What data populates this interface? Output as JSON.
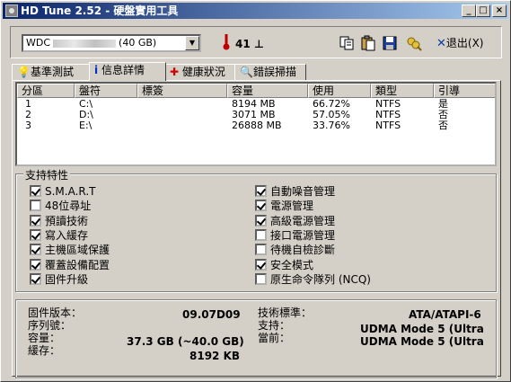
{
  "window": {
    "title": "HD Tune 2.52 - 硬盤實用工具",
    "min": "_",
    "max": "□",
    "close": "×"
  },
  "toolbar": {
    "drive_prefix": "WDC",
    "drive_suffix": "(40 GB)",
    "temperature": "41",
    "temp_unit": "⊥",
    "exit_label": "退出(X)"
  },
  "tabs": [
    {
      "label": "基準測試",
      "icon": "lightbulb-icon"
    },
    {
      "label": "信息詳情",
      "icon": "info-icon"
    },
    {
      "label": "健康狀況",
      "icon": "health-cross-icon"
    },
    {
      "label": "錯誤掃描",
      "icon": "magnifier-icon"
    }
  ],
  "partitions": {
    "headers": [
      "分區",
      "盤符",
      "標簽",
      "容量",
      "使用",
      "類型",
      "引導"
    ],
    "rows": [
      [
        "1",
        "C:\\",
        "",
        "8194 MB",
        "66.72%",
        "NTFS",
        "是"
      ],
      [
        "2",
        "D:\\",
        "",
        "3071 MB",
        "57.05%",
        "NTFS",
        "否"
      ],
      [
        "3",
        "E:\\",
        "",
        "26888 MB",
        "33.76%",
        "NTFS",
        "否"
      ]
    ]
  },
  "features": {
    "title": "支持特性",
    "left": [
      {
        "label": "S.M.A.R.T",
        "checked": true
      },
      {
        "label": "48位尋址",
        "checked": false
      },
      {
        "label": "預讀技術",
        "checked": true
      },
      {
        "label": "寫入緩存",
        "checked": true
      },
      {
        "label": "主機區域保護",
        "checked": true
      },
      {
        "label": "覆蓋設備配置",
        "checked": true
      },
      {
        "label": "固件升級",
        "checked": true
      }
    ],
    "right": [
      {
        "label": "自動噪音管理",
        "checked": true
      },
      {
        "label": "電源管理",
        "checked": true
      },
      {
        "label": "高級電源管理",
        "checked": true
      },
      {
        "label": "接口電源管理",
        "checked": false
      },
      {
        "label": "待機自檢診斷",
        "checked": false
      },
      {
        "label": "安全模式",
        "checked": true
      },
      {
        "label": "原生命令隊列 (NCQ)",
        "checked": false
      }
    ]
  },
  "details": {
    "firmware_label": "固件版本：",
    "firmware_value": "09.07D09",
    "serial_label": "序列號：",
    "serial_value": "",
    "capacity_label": "容量：",
    "capacity_value": "37.3 GB (~40.0 GB)",
    "cache_label": "緩存：",
    "cache_value": "8192 KB",
    "standard_label": "技術標準：",
    "standard_value": "ATA/ATAPI-6",
    "support_label": "支持：",
    "support_value": "UDMA Mode 5 (Ultra",
    "current_label": "當前：",
    "current_value": "UDMA Mode 5 (Ultra"
  }
}
